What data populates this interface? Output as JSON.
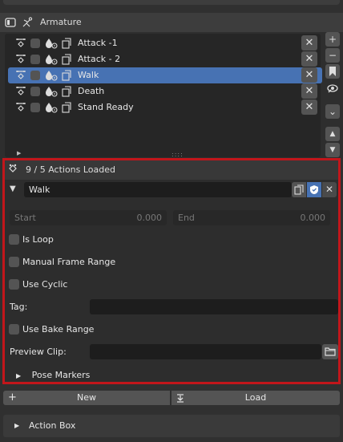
{
  "header": {
    "title": "Armature",
    "panel_icon": "panel-toggle-icon",
    "armature_icon": "armature-icon"
  },
  "list": {
    "items": [
      {
        "label": "Attack -1",
        "selected": false
      },
      {
        "label": "Attack - 2",
        "selected": false
      },
      {
        "label": "Walk",
        "selected": true
      },
      {
        "label": "Death",
        "selected": false
      },
      {
        "label": "Stand Ready",
        "selected": false
      }
    ],
    "remove_glyph": "✕",
    "grip_glyph": "::::",
    "side_buttons": {
      "add": "+",
      "remove": "−",
      "bookmark": "bookmark-icon",
      "visibility": "eye-icon",
      "chevron": "⌄",
      "up": "▲",
      "down": "▼"
    }
  },
  "actions": {
    "status": "9 / 5 Actions Loaded",
    "current_name": "Walk",
    "start_label": "Start",
    "start_value": "0.000",
    "end_label": "End",
    "end_value": "0.000",
    "is_loop": "Is Loop",
    "manual_frame_range": "Manual Frame Range",
    "use_cyclic": "Use Cyclic",
    "tag_label": "Tag:",
    "tag_value": "",
    "use_bake_range": "Use Bake Range",
    "preview_clip_label": "Preview Clip:",
    "preview_clip_value": "",
    "pose_markers": "Pose Markers"
  },
  "buttons": {
    "new": "New",
    "load": "Load"
  },
  "action_box": {
    "label": "Action Box"
  },
  "colors": {
    "selection": "#4772b3",
    "highlight_frame": "#c2161b",
    "shield": "#4772b3"
  }
}
